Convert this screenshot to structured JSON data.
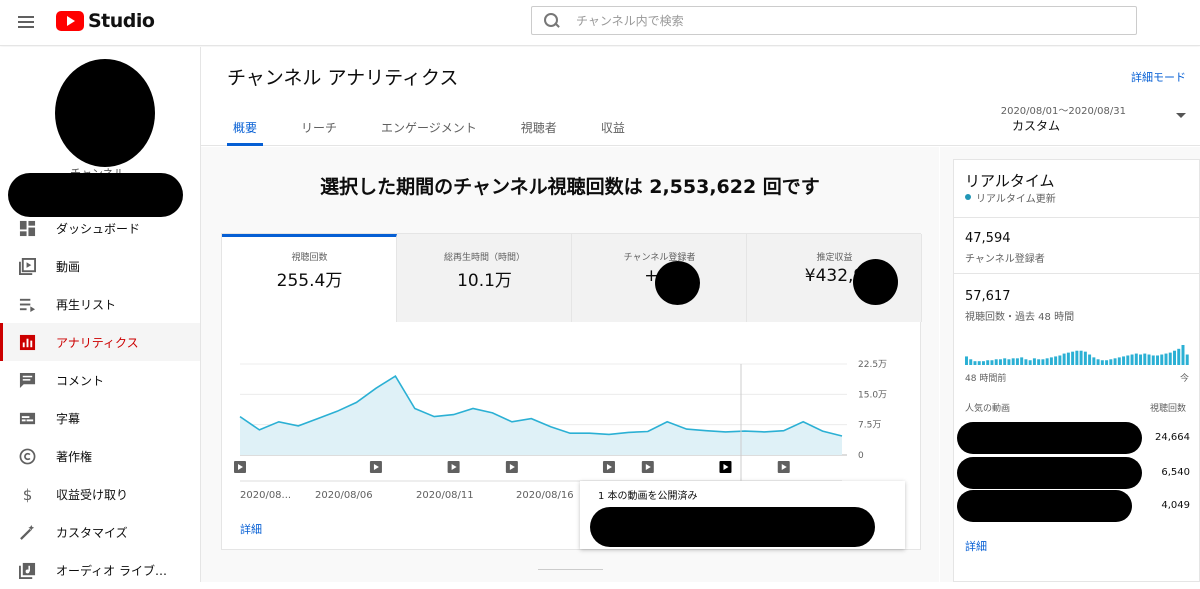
{
  "app": {
    "logo_text": "Studio"
  },
  "search": {
    "placeholder": "チャンネル内で検索",
    "value": ""
  },
  "sidebar": {
    "channel_label": "チャンネル",
    "items": [
      {
        "label": "ダッシュボード",
        "icon": "dashboard-icon"
      },
      {
        "label": "動画",
        "icon": "video-icon"
      },
      {
        "label": "再生リスト",
        "icon": "playlist-icon"
      },
      {
        "label": "アナリティクス",
        "icon": "analytics-icon",
        "active": true
      },
      {
        "label": "コメント",
        "icon": "comment-icon"
      },
      {
        "label": "字幕",
        "icon": "subtitles-icon"
      },
      {
        "label": "著作権",
        "icon": "copyright-icon"
      },
      {
        "label": "収益受け取り",
        "icon": "dollar-icon"
      },
      {
        "label": "カスタマイズ",
        "icon": "magic-wand-icon"
      },
      {
        "label": "オーディオ ライブ…",
        "icon": "audio-library-icon"
      }
    ]
  },
  "header": {
    "title": "チャンネル アナリティクス",
    "advanced_mode": "詳細モード",
    "tabs": [
      "概要",
      "リーチ",
      "エンゲージメント",
      "視聴者",
      "収益"
    ],
    "active_tab": 0,
    "date_range": "2020/08/01～2020/08/31",
    "date_mode": "カスタム"
  },
  "overview": {
    "headline": "選択した期間のチャンネル視聴回数は 2,553,622 回です",
    "metrics": [
      {
        "label": "視聴回数",
        "value": "255.4万"
      },
      {
        "label": "総再生時間（時間）",
        "value": "10.1万"
      },
      {
        "label": "チャンネル登録者",
        "value": "+3,"
      },
      {
        "label": "推定収益",
        "value": "¥432,9"
      }
    ],
    "details_link": "詳細",
    "tooltip_text": "1 本の動画を公開済み"
  },
  "chart_data": {
    "type": "area",
    "x_labels": [
      "2020/08...",
      "2020/08/06",
      "2020/08/11",
      "2020/08/16"
    ],
    "y_ticks": [
      "22.5万",
      "15.0万",
      "7.5万",
      "0"
    ],
    "ylim": [
      0,
      225000
    ],
    "values": [
      95000,
      62000,
      82000,
      72000,
      90000,
      108000,
      130000,
      165000,
      195000,
      115000,
      95000,
      100000,
      115000,
      104000,
      82000,
      90000,
      70000,
      54000,
      54000,
      51000,
      56000,
      58000,
      82000,
      64000,
      60000,
      57000,
      59000,
      57000,
      60000,
      82000,
      59000,
      47000
    ],
    "publish_markers": [
      0,
      7,
      11,
      14,
      19,
      21,
      25,
      28
    ],
    "highlighted_marker": 25,
    "color": "#2bb0d4"
  },
  "realtime": {
    "title": "リアルタイム",
    "subtitle": "リアルタイム更新",
    "subscribers": "47,594",
    "subscribers_label": "チャンネル登録者",
    "views": "57,617",
    "views_label": "視聴回数・過去 48 時間",
    "axis_left": "48 時間前",
    "axis_right": "今",
    "popular_label": "人気の動画",
    "views_header": "視聴回数",
    "videos": [
      {
        "views": "24,664"
      },
      {
        "views": "6,540"
      },
      {
        "views": "4,049"
      }
    ],
    "details_link": "詳細",
    "bars": [
      9,
      6,
      4,
      4,
      4,
      5,
      5,
      6,
      6,
      7,
      6,
      7,
      7,
      8,
      6,
      5,
      7,
      6,
      6,
      7,
      8,
      9,
      10,
      12,
      13,
      14,
      15,
      15,
      14,
      11,
      8,
      6,
      5,
      5,
      6,
      7,
      8,
      9,
      10,
      11,
      12,
      11,
      12,
      11,
      10,
      10,
      11,
      12,
      13,
      15,
      17,
      21,
      11
    ],
    "bar_color": "#2bb0d4"
  }
}
